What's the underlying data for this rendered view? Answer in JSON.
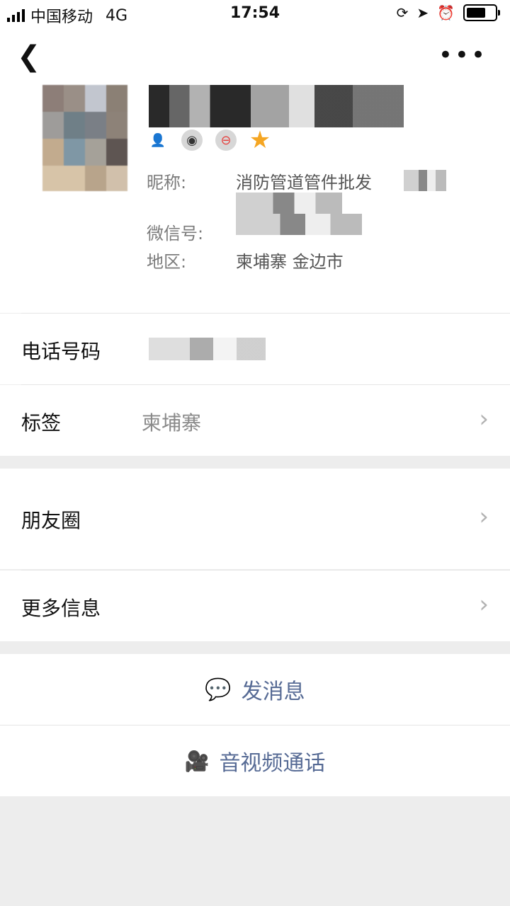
{
  "status_bar": {
    "carrier": "中国移动",
    "network": "4G",
    "time": "17:54"
  },
  "nav": {
    "back_icon": "chevron-left-icon",
    "more_icon": "more-dots-icon"
  },
  "profile": {
    "nickname_label": "昵称:",
    "nickname_value": "消防管道管件批发",
    "wechat_id_label": "微信号:",
    "region_label": "地区:",
    "region_value": "柬埔寨 金边市"
  },
  "rows": {
    "phone_label": "电话号码",
    "tag_label": "标签",
    "tag_value": "柬埔寨",
    "moments_label": "朋友圈",
    "more_info_label": "更多信息"
  },
  "actions": {
    "message_label": "发消息",
    "call_label": "音视频通话"
  },
  "colors": {
    "link": "#576b95",
    "star": "#f5a623",
    "divider": "#dcdcdc"
  }
}
